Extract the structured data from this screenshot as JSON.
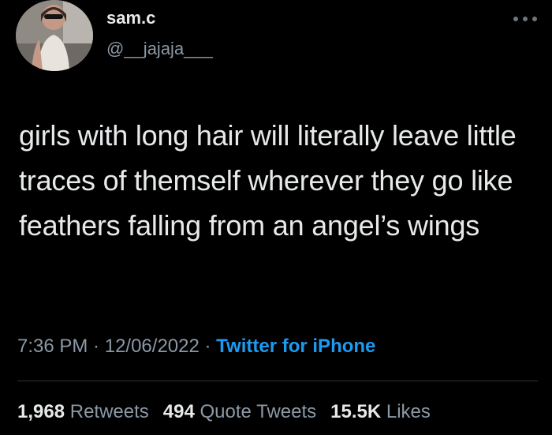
{
  "author": {
    "display_name": "sam.c",
    "handle": "@__jajaja___"
  },
  "tweet": {
    "text": "girls with long hair will literally leave little traces of themself wherever they go like feathers falling from an angel’s wings"
  },
  "meta": {
    "time": "7:36 PM",
    "separator": " · ",
    "date": "12/06/2022",
    "source": "Twitter for iPhone"
  },
  "stats": {
    "retweets": {
      "count": "1,968",
      "label": "Retweets"
    },
    "quotes": {
      "count": "494",
      "label": "Quote Tweets"
    },
    "likes": {
      "count": "15.5K",
      "label": "Likes"
    }
  },
  "icons": {
    "more": "more-horizontal-icon"
  },
  "colors": {
    "background": "#000000",
    "text": "#e7e9ea",
    "secondary": "#8b98a5",
    "link": "#1d9bf0"
  }
}
